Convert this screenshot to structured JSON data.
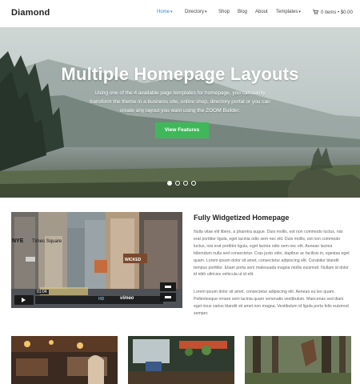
{
  "header": {
    "logo": "Diamond",
    "nav": [
      {
        "label": "Home",
        "active": true,
        "dropdown": true
      },
      {
        "label": "Directory",
        "active": false,
        "dropdown": true
      },
      {
        "label": "Shop",
        "active": false,
        "dropdown": false
      },
      {
        "label": "Blog",
        "active": false,
        "dropdown": false
      },
      {
        "label": "About",
        "active": false,
        "dropdown": false
      },
      {
        "label": "Templates",
        "active": false,
        "dropdown": true
      }
    ],
    "cart": "0 items • $0.00"
  },
  "hero": {
    "title": "Multiple Homepage Layouts",
    "text": "Using one of the 4 available page templates for homepage, you can easily transform the theme in a business site, online shop, directory portal or you can create any layout you want using the ZOOM Builder.",
    "button": "View Features",
    "slides": 4,
    "active_slide": 1
  },
  "feature": {
    "title": "Fully Widgetized Homepage",
    "p1": "Nulla vitae elit libero, a pharetra augue. Duis mollis, est non commodo luctus, nisi erat porttitor ligula, eget lacinia odio sem nec elit. Duis mollis, est non commodo luctus, nisi erat porttitor ligula, eget lacinia odio sem nec elit. Aenean lacinia bibendum nulla sed consectetur. Cras justo odio, dapibus ac facilisis in, egestas eget quam. Lorem ipsum dolor sit amet, consectetur adipiscing elit. Curabitur blandit tempus porttitor. Etiam porta sem malesuada magna mollis euismod. Nullam id dolor id nibh ultricies vehicula ut id elit.",
    "p2": "Lorem ipsum dolor sit amet, consectetur adipiscing elit. Aenean eu leo quam. Pellentesque ornare sem lacinia quam venenatis vestibulum. Maecenas sed diam eget risus varius blandit sit amet non magna. Vestibulum id ligula porta felis euismod semper.",
    "video": {
      "sign_left": "NYE",
      "sign_times": "Times Square",
      "sign_wicked": "WICKED",
      "time": "01:04",
      "hd": "HD",
      "brand": "vimeo"
    }
  },
  "colors": {
    "accent": "#2a8fd6",
    "button": "#3fb85a"
  }
}
